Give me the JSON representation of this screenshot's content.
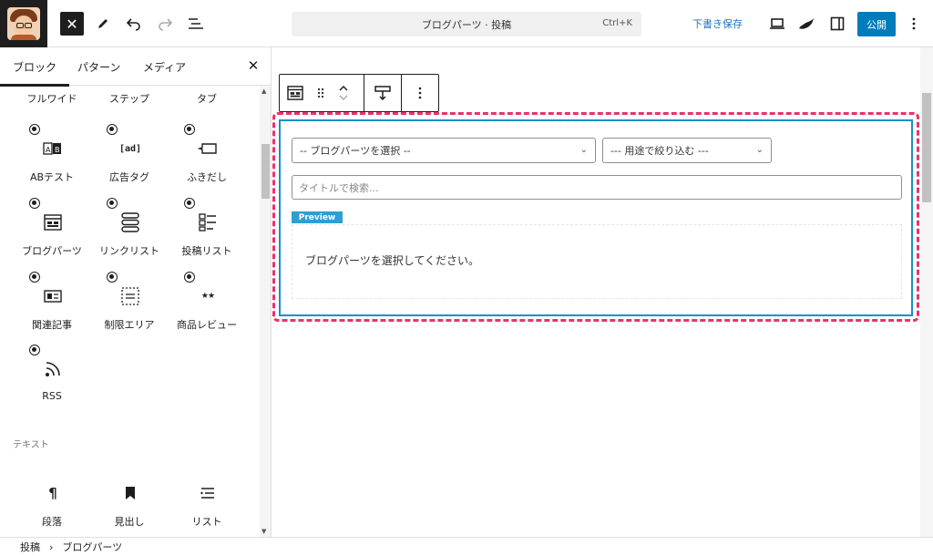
{
  "header": {
    "command_bar": {
      "title": "ブログパーツ · 投稿",
      "shortcut": "Ctrl+K"
    },
    "save_draft": "下書き保存",
    "publish": "公開",
    "close_glyph": "✕"
  },
  "sidebar": {
    "tabs": [
      "ブロック",
      "パターン",
      "メディア"
    ],
    "active_tab": "ブロック",
    "close_glyph": "✕",
    "partial_row": [
      "フルワイド",
      "ステップ",
      "タブ"
    ],
    "blocks": [
      {
        "label": "ABテスト",
        "icon": "ab-test-icon",
        "glyph": "A|B"
      },
      {
        "label": "広告タグ",
        "icon": "ad-tag-icon",
        "glyph": "[ad]"
      },
      {
        "label": "ふきだし",
        "icon": "speech-bubble-icon",
        "glyph": ""
      },
      {
        "label": "ブログパーツ",
        "icon": "blog-parts-icon",
        "glyph": ""
      },
      {
        "label": "リンクリスト",
        "icon": "link-list-icon",
        "glyph": ""
      },
      {
        "label": "投稿リスト",
        "icon": "post-list-icon",
        "glyph": ""
      },
      {
        "label": "関連記事",
        "icon": "related-posts-icon",
        "glyph": ""
      },
      {
        "label": "制限エリア",
        "icon": "restricted-area-icon",
        "glyph": ""
      },
      {
        "label": "商品レビュー",
        "icon": "product-review-icon",
        "glyph": "★★"
      },
      {
        "label": "RSS",
        "icon": "rss-icon",
        "glyph": ""
      }
    ],
    "text_section_title": "テキスト",
    "text_blocks": [
      {
        "label": "段落",
        "icon": "paragraph-icon",
        "glyph": "¶"
      },
      {
        "label": "見出し",
        "icon": "heading-icon",
        "glyph": ""
      },
      {
        "label": "リスト",
        "icon": "list-icon",
        "glyph": ""
      }
    ]
  },
  "block": {
    "select_parts": "-- ブログパーツを選択 --",
    "select_purpose": "--- 用途で絞り込む ---",
    "search_placeholder": "タイトルで検索...",
    "preview_label": "Preview",
    "preview_text": "ブログパーツを選択してください。"
  },
  "footer": {
    "breadcrumb": [
      "投稿",
      "ブログパーツ"
    ],
    "separator": "›"
  },
  "colors": {
    "accent": "#007cba",
    "highlight_dash": "#e8336e",
    "block_border": "#1a8fcc",
    "preview_tag": "#2e9fd2"
  }
}
